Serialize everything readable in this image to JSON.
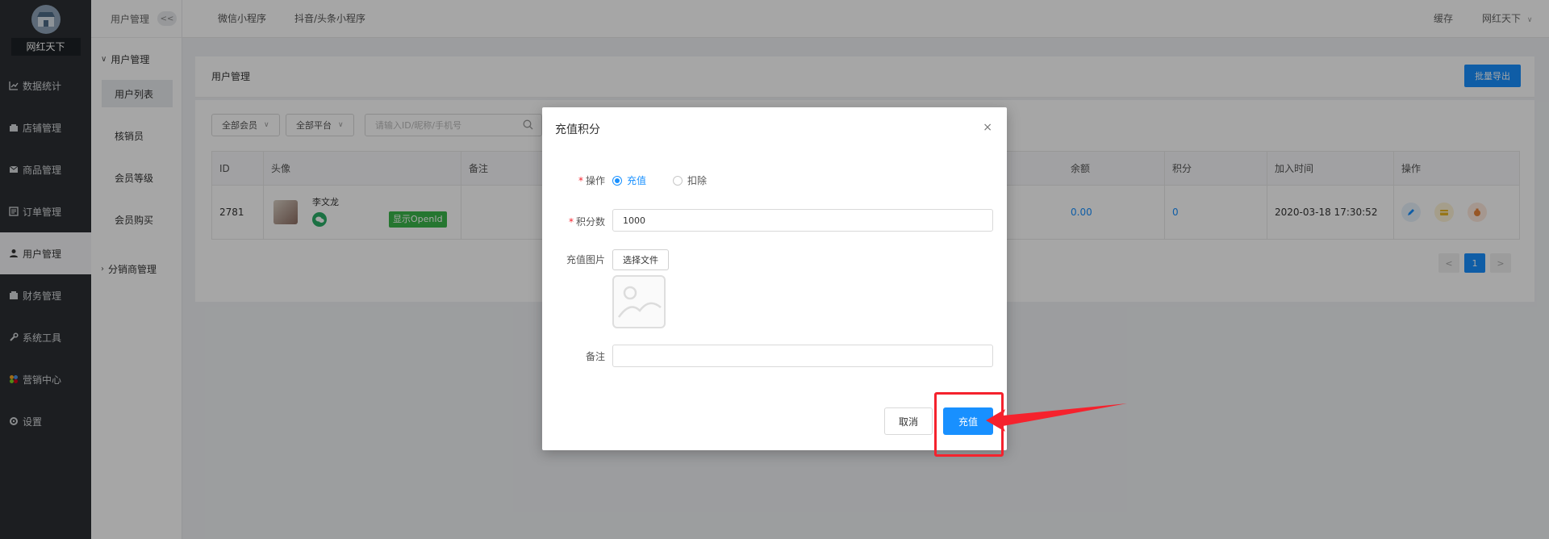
{
  "sidebar": {
    "brand": "网红天下",
    "items": [
      {
        "label": "数据统计",
        "icon": "chart-line-icon"
      },
      {
        "label": "店铺管理",
        "icon": "shop-icon"
      },
      {
        "label": "商品管理",
        "icon": "product-icon"
      },
      {
        "label": "订单管理",
        "icon": "order-icon"
      },
      {
        "label": "用户管理",
        "icon": "user-icon",
        "active": true
      },
      {
        "label": "财务管理",
        "icon": "finance-icon"
      },
      {
        "label": "系统工具",
        "icon": "wrench-icon"
      },
      {
        "label": "营销中心",
        "icon": "marketing-icon"
      },
      {
        "label": "设置",
        "icon": "gear-icon"
      }
    ]
  },
  "submenu": {
    "header": "用户管理",
    "collapse": "<<",
    "groups": [
      {
        "label": "用户管理",
        "items": [
          "用户列表",
          "核销员",
          "会员等级",
          "会员购买"
        ]
      },
      {
        "label": "分销商管理"
      }
    ]
  },
  "topbar": {
    "tabs": [
      "微信小程序",
      "抖音/头条小程序"
    ],
    "right": [
      "缓存",
      "网红天下"
    ]
  },
  "page": {
    "title": "用户管理",
    "export_button": "批量导出",
    "filters": [
      "全部会员",
      "全部平台"
    ],
    "search_placeholder": "请输入ID/昵称/手机号"
  },
  "table": {
    "headers": [
      "ID",
      "头像",
      "备注",
      "余额",
      "积分",
      "加入时间",
      "操作"
    ],
    "rows": [
      {
        "id": "2781",
        "nickname": "李文龙",
        "openid_tag": "显示OpenId",
        "balance": "0.00",
        "points": "0",
        "joined": "2020-03-18 17:30:52"
      }
    ]
  },
  "pager": {
    "prev": "<",
    "current": "1",
    "next": ">"
  },
  "modal": {
    "title": "充值积分",
    "close": "×",
    "op_label": "操作",
    "op_options": [
      "充值",
      "扣除"
    ],
    "op_selected": "充值",
    "points_label": "积分数",
    "points_value": "1000",
    "image_label": "充值图片",
    "choose_file": "选择文件",
    "remark_label": "备注",
    "remark_value": "",
    "cancel": "取消",
    "confirm": "充值"
  },
  "colors": {
    "primary": "#1890ff",
    "sidebar": "#2b2f33",
    "annotation": "#f5222d",
    "tag_green": "#3ab54a"
  }
}
